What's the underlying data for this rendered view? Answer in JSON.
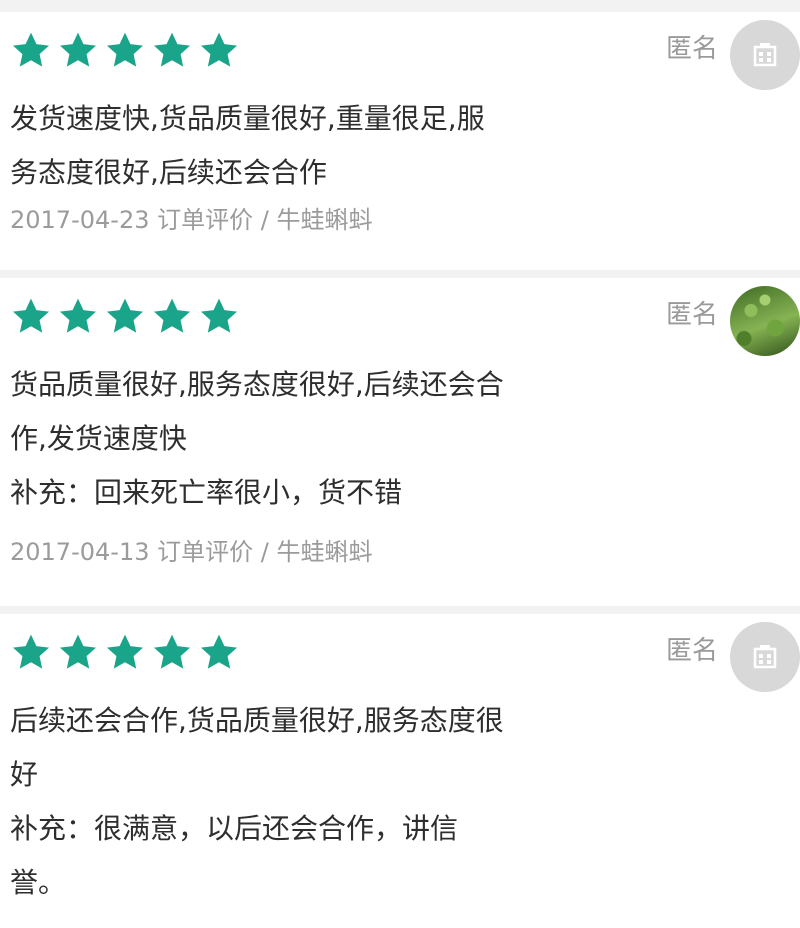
{
  "colors": {
    "star": "#1aa58a",
    "background": "#f2f2f2",
    "card": "#ffffff",
    "muted": "#9b9b9b"
  },
  "reviews": [
    {
      "rating": 5,
      "user_label": "匿名",
      "avatar": "default-avatar-icon",
      "lines": [
        "发货速度快,货品质量很好,重量很足,服",
        "务态度很好,后续还会合作"
      ],
      "meta": "2017-04-23 订单评价 / 牛蛙蝌蚪"
    },
    {
      "rating": 5,
      "user_label": "匿名",
      "avatar": "grass-photo",
      "lines": [
        "货品质量很好,服务态度很好,后续还会合",
        "作,发货速度快",
        "补充：回来死亡率很小，货不错"
      ],
      "meta": "2017-04-13 订单评价 / 牛蛙蝌蚪"
    },
    {
      "rating": 5,
      "user_label": "匿名",
      "avatar": "default-avatar-icon",
      "lines": [
        "后续还会合作,货品质量很好,服务态度很",
        "好",
        "补充：很满意，以后还会合作，讲信",
        "誉。"
      ],
      "meta": ""
    }
  ]
}
